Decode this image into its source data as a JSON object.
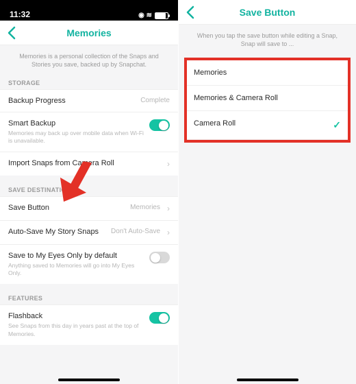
{
  "left": {
    "status_time": "11:32",
    "nav_title": "Memories",
    "subtext": "Memories is a personal collection of the Snaps and Stories you save, backed up by Snapchat.",
    "sec_storage": "STORAGE",
    "storage": {
      "backup_title": "Backup Progress",
      "backup_value": "Complete",
      "smart_title": "Smart Backup",
      "smart_desc": "Memories may back up over mobile data when Wi-Fi is unavailable.",
      "import_title": "Import Snaps from Camera Roll"
    },
    "sec_save": "SAVE DESTINATIONS",
    "save": {
      "button_title": "Save Button",
      "button_value": "Memories",
      "auto_title": "Auto-Save My Story Snaps",
      "auto_value": "Don't Auto-Save",
      "eyes_title": "Save to My Eyes Only by default",
      "eyes_desc": "Anything saved to Memories will go into My Eyes Only."
    },
    "sec_features": "FEATURES",
    "features": {
      "flash_title": "Flashback",
      "flash_desc": "See Snaps from this day in years past at the top of Memories."
    }
  },
  "right": {
    "nav_title": "Save Button",
    "subtext": "When you tap the save button while editing a Snap, Snap will save to ...",
    "options": {
      "o1": "Memories",
      "o2": "Memories & Camera Roll",
      "o3": "Camera Roll"
    }
  }
}
